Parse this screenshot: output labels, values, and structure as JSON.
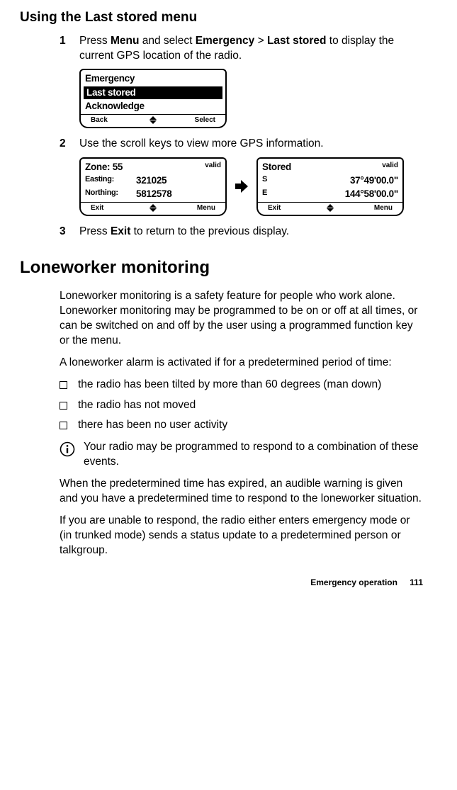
{
  "section_title": "Using the Last stored menu",
  "steps": {
    "s1_num": "1",
    "s1_a": "Press ",
    "s1_b1": "Menu",
    "s1_c": " and select ",
    "s1_b2": "Emergency",
    "s1_d": " > ",
    "s1_b3": "Last stored",
    "s1_e": " to display the current GPS location of the radio.",
    "s2_num": "2",
    "s2": "Use the scroll keys to view more GPS information.",
    "s3_num": "3",
    "s3_a": "Press ",
    "s3_b": "Exit",
    "s3_c": " to return to the previous display."
  },
  "lcd1": {
    "title": "Emergency",
    "sel": "Last stored",
    "other": "Acknowledge",
    "left": "Back",
    "right": "Select"
  },
  "lcd2": {
    "title": "Zone: 55",
    "valid": "valid",
    "l1_lbl": "Easting:",
    "l1_val": "321025",
    "l2_lbl": "Northing:",
    "l2_val": "5812578",
    "left": "Exit",
    "right": "Menu"
  },
  "lcd3": {
    "title": "Stored",
    "valid": "valid",
    "l1_lbl": "S",
    "l1_val": "37°49'00.0\"",
    "l2_lbl": "E",
    "l2_val": "144°58'00.0\"",
    "left": "Exit",
    "right": "Menu"
  },
  "heading": "Loneworker monitoring",
  "p1": "Loneworker monitoring is a safety feature for people who work alone. Loneworker monitoring may be programmed to be on or off at all times, or can be switched on and off by the user using a programmed function key or the menu.",
  "p2": "A loneworker alarm is activated if for a predetermined period of time:",
  "b1": "the radio has been tilted by more than 60 degrees (man down)",
  "b2": "the radio has not moved",
  "b3": "there has been no user activity",
  "info": "Your radio may be programmed to respond to a combination of these events.",
  "p3": "When the predetermined time has expired, an audible warning is given and you have a predetermined time to respond to the loneworker situation.",
  "p4": "If you are unable to respond, the radio either enters emergency mode or (in trunked mode) sends a status update to a predetermined person or talkgroup.",
  "footer_label": "Emergency operation",
  "footer_page": "111"
}
